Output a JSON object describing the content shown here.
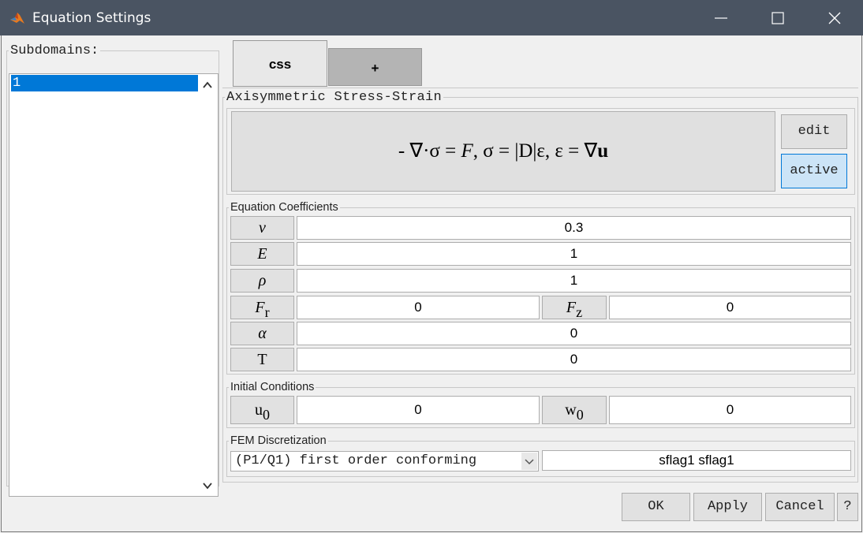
{
  "window": {
    "title": "Equation Settings",
    "controls": {
      "minimize_icon": "minimize-icon",
      "maximize_icon": "maximize-icon",
      "close_icon": "close-icon"
    }
  },
  "subdomains": {
    "label": "Subdomains:",
    "items": [
      "1"
    ],
    "selected": "1"
  },
  "tabs": [
    {
      "label": "css",
      "active": true
    },
    {
      "label": "+",
      "active": false
    }
  ],
  "equation_panel": {
    "title": "Axisymmetric Stress-Strain",
    "equation": "- ∇·σ = F, σ = |D|ε, ε = ∇u",
    "edit_label": "edit",
    "active_label": "active"
  },
  "coefficients": {
    "title": "Equation Coefficients",
    "nu": {
      "label": "ν",
      "value": "0.3"
    },
    "E": {
      "label": "E",
      "value": "1"
    },
    "rho": {
      "label": "ρ",
      "value": "1"
    },
    "Fr": {
      "label": "F",
      "sub": "r",
      "value": "0"
    },
    "Fz": {
      "label": "F",
      "sub": "z",
      "value": "0"
    },
    "alpha": {
      "label": "α",
      "value": "0"
    },
    "T": {
      "label": "T",
      "value": "0"
    }
  },
  "initial_conditions": {
    "title": "Initial Conditions",
    "u0": {
      "label": "u",
      "sub": "0",
      "value": "0"
    },
    "w0": {
      "label": "w",
      "sub": "0",
      "value": "0"
    }
  },
  "fem": {
    "title": "FEM Discretization",
    "element": "(P1/Q1) first order conforming",
    "flags": "sflag1 sflag1"
  },
  "buttons": {
    "ok": "OK",
    "apply": "Apply",
    "cancel": "Cancel",
    "help": "?"
  },
  "colors": {
    "titlebar": "#4a5462",
    "selection": "#0078d7",
    "active_button": "#cce4f7"
  }
}
